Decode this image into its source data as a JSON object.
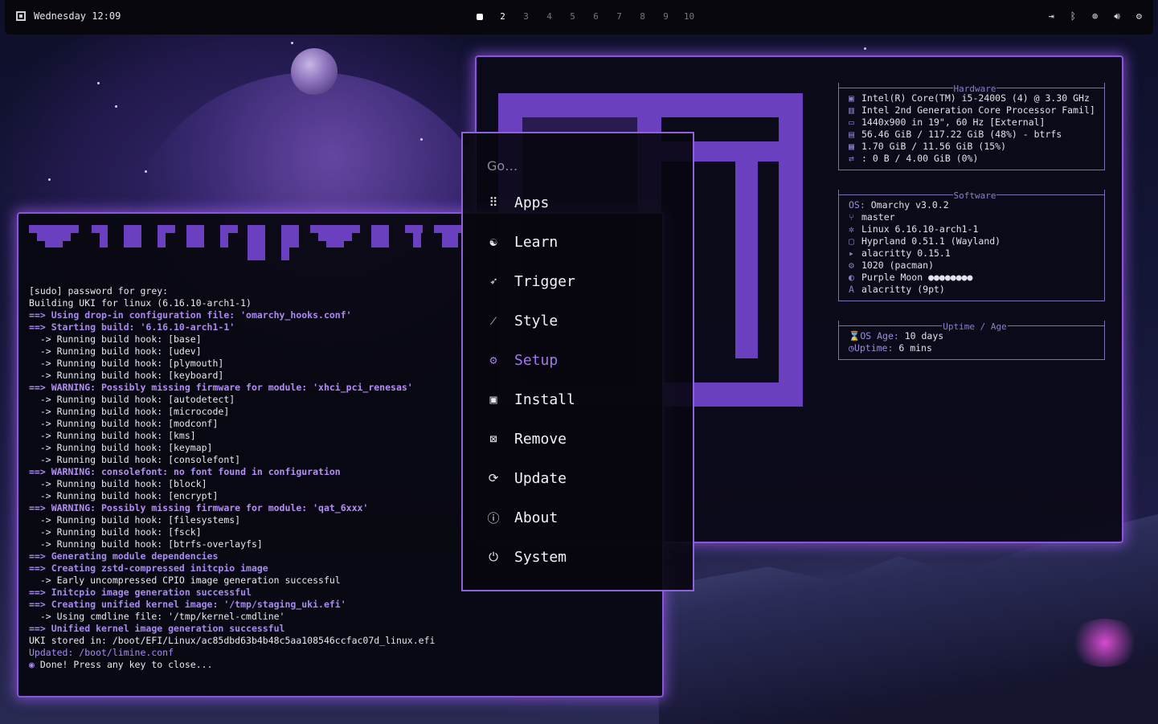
{
  "topbar": {
    "datetime": "Wednesday 12:09",
    "workspaces": [
      "2",
      "3",
      "4",
      "5",
      "6",
      "7",
      "8",
      "9",
      "10"
    ],
    "tray_icons": [
      "logout-icon",
      "bluetooth-icon",
      "network-icon",
      "volume-icon",
      "settings-icon"
    ]
  },
  "menu": {
    "placeholder": "Go…",
    "items": [
      {
        "label": "Apps",
        "icon": "grid-icon"
      },
      {
        "label": "Learn",
        "icon": "brain-icon"
      },
      {
        "label": "Trigger",
        "icon": "rocket-icon"
      },
      {
        "label": "Style",
        "icon": "wand-icon"
      },
      {
        "label": "Setup",
        "icon": "gear-icon"
      },
      {
        "label": "Install",
        "icon": "floppy-icon"
      },
      {
        "label": "Remove",
        "icon": "remove-icon"
      },
      {
        "label": "Update",
        "icon": "refresh-icon"
      },
      {
        "label": "About",
        "icon": "info-icon"
      },
      {
        "label": "System",
        "icon": "power-icon"
      }
    ],
    "selected": "Setup",
    "accent": "#a577ea"
  },
  "fastfetch": {
    "hardware_title": "Hardware",
    "hardware": [
      "Intel(R) Core(TM) i5-2400S (4) @ 3.30 GHz",
      "Intel 2nd Generation Core Processor Famil]",
      "1440x900 in 19\", 60 Hz [External]",
      "56.46 GiB / 117.22 GiB (48%) - btrfs",
      "1.70 GiB / 11.56 GiB (15%)",
      ": 0 B / 4.00 GiB (0%)"
    ],
    "software_title": "Software",
    "os_label": "OS:",
    "software": [
      "Omarchy v3.0.2",
      "master",
      "Linux 6.16.10-arch1-1",
      "Hyprland 0.51.1 (Wayland)",
      "alacritty 0.15.1",
      "1020 (pacman)",
      "Purple Moon ●●●●●●●●",
      "alacritty (9pt)"
    ],
    "uptime_title": "Uptime / Age",
    "os_age_label": "OS Age:",
    "os_age": "10 days",
    "uptime_label": "Uptime:",
    "uptime": "6 mins"
  },
  "terminal": {
    "lines": [
      "[sudo] password for grey:",
      "Building UKI for linux (6.16.10-arch1-1)",
      "==> Using drop-in configuration file: 'omarchy_hooks.conf'",
      "==> Starting build: '6.16.10-arch1-1'",
      "  -> Running build hook: [base]",
      "  -> Running build hook: [udev]",
      "  -> Running build hook: [plymouth]",
      "  -> Running build hook: [keyboard]",
      "==> WARNING: Possibly missing firmware for module: 'xhci_pci_renesas'",
      "  -> Running build hook: [autodetect]",
      "  -> Running build hook: [microcode]",
      "  -> Running build hook: [modconf]",
      "  -> Running build hook: [kms]",
      "  -> Running build hook: [keymap]",
      "  -> Running build hook: [consolefont]",
      "==> WARNING: consolefont: no font found in configuration",
      "  -> Running build hook: [block]",
      "  -> Running build hook: [encrypt]",
      "==> WARNING: Possibly missing firmware for module: 'qat_6xxx'",
      "  -> Running build hook: [filesystems]",
      "  -> Running build hook: [fsck]",
      "  -> Running build hook: [btrfs-overlayfs]",
      "==> Generating module dependencies",
      "==> Creating zstd-compressed initcpio image",
      "  -> Early uncompressed CPIO image generation successful",
      "==> Initcpio image generation successful",
      "==> Creating unified kernel image: '/tmp/staging_uki.efi'",
      "  -> Using cmdline file: '/tmp/kernel-cmdline'",
      "==> Unified kernel image generation successful",
      "UKI stored in: /boot/EFI/Linux/ac85dbd63b4b48c5aa108546ccfac07d_linux.efi",
      "Updated: /boot/limine.conf",
      "",
      "Done! Press any key to close..."
    ]
  }
}
